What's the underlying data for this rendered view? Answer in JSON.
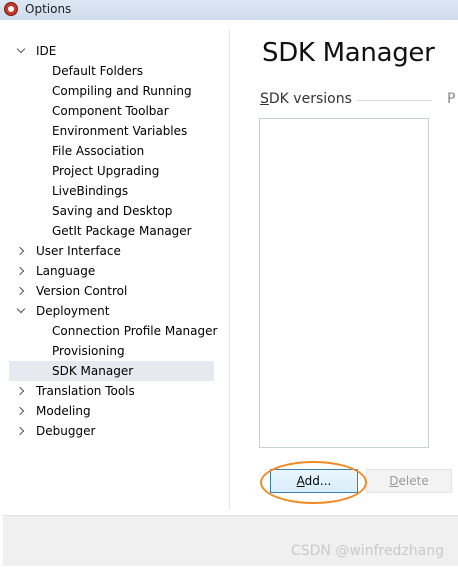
{
  "window": {
    "title": "Options"
  },
  "tree": [
    {
      "label": "IDE",
      "level": 0,
      "expander": "down"
    },
    {
      "label": "Default Folders",
      "level": 1
    },
    {
      "label": "Compiling and Running",
      "level": 1
    },
    {
      "label": "Component Toolbar",
      "level": 1
    },
    {
      "label": "Environment Variables",
      "level": 1
    },
    {
      "label": "File Association",
      "level": 1
    },
    {
      "label": "Project Upgrading",
      "level": 1
    },
    {
      "label": "LiveBindings",
      "level": 1
    },
    {
      "label": "Saving and Desktop",
      "level": 1
    },
    {
      "label": "GetIt Package Manager",
      "level": 1
    },
    {
      "label": "User Interface",
      "level": 0,
      "expander": "right"
    },
    {
      "label": "Language",
      "level": 0,
      "expander": "right"
    },
    {
      "label": "Version Control",
      "level": 0,
      "expander": "right"
    },
    {
      "label": "Deployment",
      "level": 0,
      "expander": "down"
    },
    {
      "label": "Connection Profile Manager",
      "level": 1
    },
    {
      "label": "Provisioning",
      "level": 1
    },
    {
      "label": "SDK Manager",
      "level": 1,
      "selected": true
    },
    {
      "label": "Translation Tools",
      "level": 0,
      "expander": "right"
    },
    {
      "label": "Modeling",
      "level": 0,
      "expander": "right"
    },
    {
      "label": "Debugger",
      "level": 0,
      "expander": "right"
    }
  ],
  "panel": {
    "title": "SDK Manager",
    "section_label_first": "S",
    "section_label_rest": "DK versions",
    "cut_letter": "P",
    "add_button_mnemonic": "A",
    "add_button_rest": "dd...",
    "delete_button_mnemonic": "D",
    "delete_button_rest": "elete"
  },
  "watermark": "CSDN @winfredzhang",
  "colors": {
    "highlight": "#f08a24",
    "selection": "#e6eaf0"
  }
}
